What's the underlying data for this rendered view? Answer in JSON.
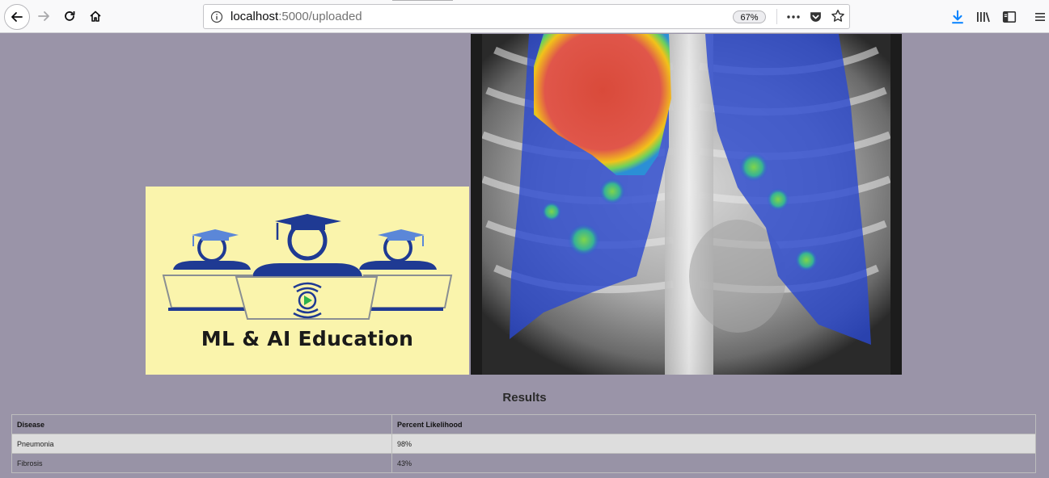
{
  "browser": {
    "url_host": "localhost",
    "url_path": ":5000/uploaded",
    "zoom": "67%"
  },
  "logo": {
    "caption": "ML & AI Education",
    "colors": {
      "background": "#faf4ac",
      "figures": "#1f3a93",
      "accent": "#5b87d8",
      "play": "#2bb24c"
    }
  },
  "results": {
    "title": "Results",
    "headers": [
      "Disease",
      "Percent Likelihood"
    ],
    "rows": [
      [
        "Pneumonia",
        "98%"
      ],
      [
        "Fibrosis",
        "43%"
      ]
    ]
  }
}
